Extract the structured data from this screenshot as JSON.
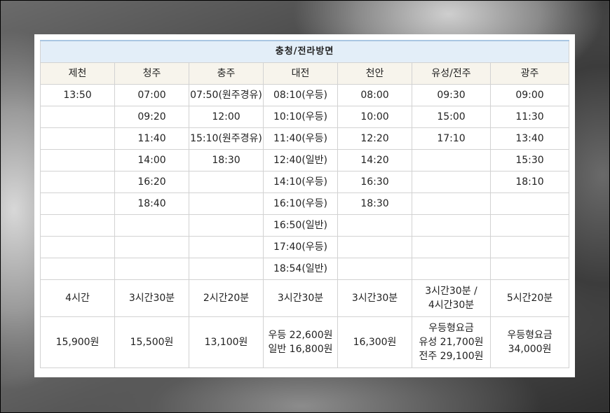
{
  "title": "충청/전라방면",
  "columns": [
    "제천",
    "청주",
    "충주",
    "대전",
    "천안",
    "유성/전주",
    "광주"
  ],
  "times": [
    [
      "13:50",
      "07:00",
      "07:50(원주경유)",
      "08:10(우등)",
      "08:00",
      "09:30",
      "09:00"
    ],
    [
      "",
      "09:20",
      "12:00",
      "10:10(우등)",
      "10:00",
      "15:00",
      "11:30"
    ],
    [
      "",
      "11:40",
      "15:10(원주경유)",
      "11:40(우등)",
      "12:20",
      "17:10",
      "13:40"
    ],
    [
      "",
      "14:00",
      "18:30",
      "12:40(일반)",
      "14:20",
      "",
      "15:30"
    ],
    [
      "",
      "16:20",
      "",
      "14:10(우등)",
      "16:30",
      "",
      "18:10"
    ],
    [
      "",
      "18:40",
      "",
      "16:10(우등)",
      "18:30",
      "",
      ""
    ],
    [
      "",
      "",
      "",
      "16:50(일반)",
      "",
      "",
      ""
    ],
    [
      "",
      "",
      "",
      "17:40(우등)",
      "",
      "",
      ""
    ],
    [
      "",
      "",
      "",
      "18:54(일반)",
      "",
      "",
      ""
    ]
  ],
  "durations": [
    [
      "4시간"
    ],
    [
      "3시간30분"
    ],
    [
      "2시간20분"
    ],
    [
      "3시간30분"
    ],
    [
      "3시간30분"
    ],
    [
      "3시간30분 /",
      "4시간30분"
    ],
    [
      "5시간20분"
    ]
  ],
  "fares": [
    [
      "15,900원"
    ],
    [
      "15,500원"
    ],
    [
      "13,100원"
    ],
    [
      "우등 22,600원",
      "일반 16,800원"
    ],
    [
      "16,300원"
    ],
    [
      "우등형요금",
      "유성 21,700원",
      "전주 29,100원"
    ],
    [
      "우등형요금",
      "34,000원"
    ]
  ]
}
